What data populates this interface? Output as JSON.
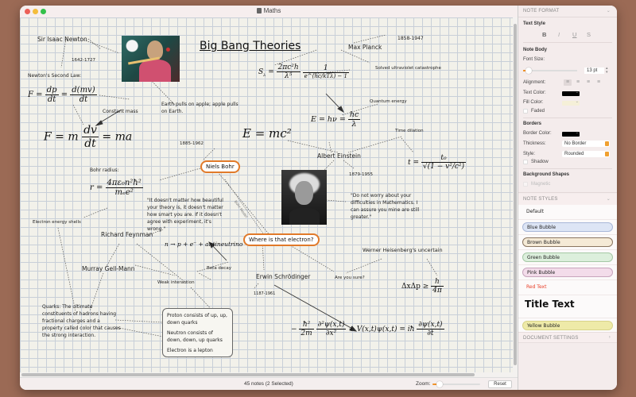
{
  "window": {
    "title": "Maths"
  },
  "canvas": {
    "title": "Big Bang Theories",
    "notes": {
      "newton": "Sir Isaac Newton",
      "newton_years": "1642-1727",
      "newton_second_law": "Newton's Second Law:",
      "constant_mass": "Constant mass",
      "earth_pulls": "Earth pulls on apple; apple pulls on Earth.",
      "planck": "Max Planck",
      "planck_years": "1858-1947",
      "ultraviolet": "Solved ultraviolet catastrophe",
      "quantum_energy": "Quantum energy",
      "einstein": "Albert Einstein",
      "einstein_years": "1879-1955",
      "time_dilation": "Time dilation",
      "einstein_quote": "\"Do not worry about your difficulties in Mathematics. I can assure you mine are still greater.\"",
      "bohr_years": "1885-1962",
      "bohr_radius": "Bohr radius:",
      "bohr_model": "Bohr Model",
      "feynman_quote": "\"It doesn't matter how beautiful your theory is, it doesn't matter how smart you are. If it doesn't agree with experiment, it's wrong.\"",
      "electron_shells": "Electron energy shells",
      "feynman": "Richard Feynman",
      "gell_mann": "Murray Gell-Mann",
      "beta_decay": "Beta decay",
      "weak_interaction": "Weak interaction",
      "quarks": "Quarks: The ultimate constituents of hadrons having fractional charges and a property called color that causes the strong interaction.",
      "proton": "Proton consists of up, up, down quarks",
      "neutron": "Neutron consists of down, down, up quarks",
      "electron_lepton": "Electron is a lepton",
      "schrodinger": "Erwin Schrödinger",
      "schrodinger_years": "1187-1961",
      "are_you_sure": "Are you sure?",
      "heisenberg": "Werner Heisenberg's uncertain"
    },
    "bubbles": {
      "niels_bohr": "Niels Bohr",
      "where_electron": "Where is that electron?"
    },
    "equations": {
      "newton_1_lhs": "F =",
      "newton_1_n1": "dp",
      "newton_1_d1": "dt",
      "newton_1_n2": "d(mv)",
      "newton_1_d2": "dt",
      "newton_2_lhs": "F = m",
      "newton_2_num": "dv",
      "newton_2_den": "dt",
      "newton_2_rhs": "= ma",
      "planck_lhs": "S",
      "planck_sub": "λ",
      "planck_num": "2πc²h",
      "planck_den": "λ⁵",
      "planck_num2": "1",
      "planck_den2": "e^(hc/kTλ) − 1",
      "quantum_lhs": "E = hν =",
      "quantum_num": "hc",
      "quantum_den": "λ",
      "emc2": "E = mc²",
      "dilation_lhs": "t =",
      "dilation_num": "t₀",
      "dilation_den": "√(1 − v²/c²)",
      "bohr_lhs": "r =",
      "bohr_num": "4πε₀n²ħ²",
      "bohr_den": "mₑe²",
      "beta": "n → p + e⁻ + antineutrino",
      "uncertainty_lhs": "ΔxΔp ≥",
      "uncertainty_num": "h",
      "uncertainty_den": "4π",
      "schrodinger_a_num": "ħ²",
      "schrodinger_a_den": "2m",
      "schrodinger_b_num": "∂²ψ(x,t)",
      "schrodinger_b_den": "∂x²",
      "schrodinger_mid": "+ V(x,t)ψ(x,t) = iħ",
      "schrodinger_c_num": "∂ψ(x,t)",
      "schrodinger_c_den": "∂t"
    },
    "images": [
      "isaac-newton-portrait",
      "albert-einstein-portrait"
    ]
  },
  "status_bar": {
    "count": "45 notes (2 Selected)",
    "zoom_label": "Zoom:",
    "zoom_fraction": 0.12,
    "reset_label": "Reset"
  },
  "sidebar": {
    "note_format_header": "NOTE FORMAT",
    "text_style_label": "Text Style",
    "text_style_buttons": [
      "B",
      "I",
      "U",
      "S"
    ],
    "note_body_label": "Note Body",
    "font_size_label": "Font Size:",
    "font_size_value": "13 pt",
    "font_size_fraction": 0.05,
    "alignment_label": "Alignment:",
    "alignment_buttons": [
      "≡",
      "≡",
      "≡",
      "≡"
    ],
    "text_color_label": "Text Color:",
    "text_color": "#000000",
    "fill_color_label": "Fill Color:",
    "fill_color": "#f5f0d8",
    "faded_label": "Faded",
    "borders_label": "Borders",
    "border_color_label": "Border Color:",
    "border_color": "#000000",
    "thickness_label": "Thickness:",
    "thickness_value": "No Border",
    "style_label": "Style:",
    "style_value": "Rounded",
    "shadow_label": "Shadow",
    "background_shapes_label": "Background Shapes",
    "magnetic_label": "Magnetic",
    "note_styles_header": "NOTE STYLES",
    "styles": [
      {
        "label": "Default",
        "bg": "",
        "border": "",
        "color": "#222222"
      },
      {
        "label": "Blue Bubble",
        "bg": "#dde5f5",
        "border": "#a9b8d8",
        "color": "#222222"
      },
      {
        "label": "Brown Bubble",
        "bg": "#f5ead6",
        "border": "#8a7560",
        "color": "#222222"
      },
      {
        "label": "Green Bubble",
        "bg": "#dcefdc",
        "border": "#a5c8a5",
        "color": "#222222"
      },
      {
        "label": "Pink Bubble",
        "bg": "#f3dcea",
        "border": "#c8a5bd",
        "color": "#222222"
      },
      {
        "label": "Red Text",
        "bg": "",
        "border": "",
        "color": "#e8402a"
      },
      {
        "label": "Title Text",
        "bg": "",
        "border": "",
        "color": "#111111"
      },
      {
        "label": "Yellow Bubble",
        "bg": "#eeeaa8",
        "border": "#d8d38a",
        "color": "#222222"
      }
    ],
    "document_settings_header": "DOCUMENT SETTINGS"
  },
  "colors": {
    "accent": "#f0932b",
    "bubble_border": "#e17a2a",
    "desktop": "#9b6a55"
  }
}
